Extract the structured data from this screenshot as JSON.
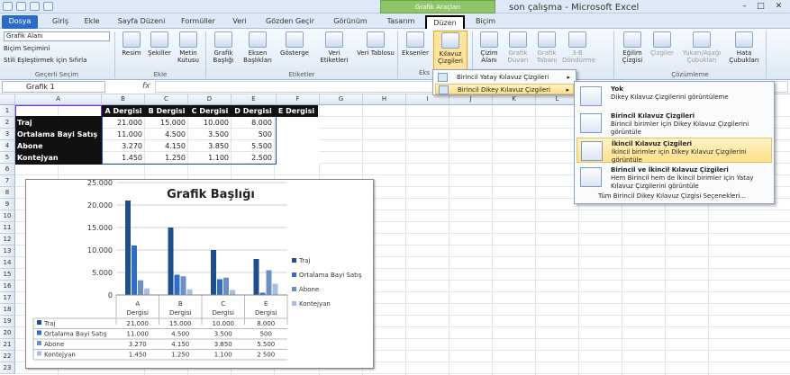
{
  "title": "son çalışma - Microsoft Excel",
  "context_tab": "Grafik Araçları",
  "window_controls": [
    "–",
    "□",
    "✕"
  ],
  "tabs": [
    "Dosya",
    "Giriş",
    "Ekle",
    "Sayfa Düzeni",
    "Formüller",
    "Veri",
    "Gözden Geçir",
    "Görünüm",
    "Tasarım",
    "Düzen",
    "Biçim"
  ],
  "ribbon": {
    "current_selection": "Grafik Alanı",
    "format_selection": "Biçim Seçimini",
    "reset_style": "Stili Eşleştirmek için Sıfırla",
    "group_current": "Geçerli Seçim",
    "group_insert": "Ekle",
    "group_labels": "Etiketler",
    "group_axes": "Eks",
    "group_analysis": "Çözümleme",
    "buttons": [
      "Resim",
      "Şekiller",
      "Metin Kutusu",
      "Grafik Başlığı",
      "Eksen Başlıkları",
      "Gösterge",
      "Veri Etiketleri",
      "Veri Tablosu",
      "Eksenler",
      "Kılavuz Çizgileri",
      "Çizim Alanı",
      "Grafik Duvarı",
      "Grafik Tabanı",
      "3-B Döndürme",
      "Eğilim Çizgisi",
      "Çizgiler",
      "Yukarı/Aşağı Çubukları",
      "Hata Çubukları"
    ]
  },
  "namebox": "Grafik 1",
  "fx": "fx",
  "columns": [
    "A",
    "B",
    "C",
    "D",
    "E",
    "F",
    "G",
    "H",
    "I",
    "J",
    "K",
    "L",
    "M",
    "N"
  ],
  "rows": [
    "1",
    "2",
    "3",
    "4",
    "5",
    "6",
    "7",
    "8",
    "9",
    "10",
    "11",
    "12",
    "13",
    "14",
    "15",
    "16",
    "17",
    "18",
    "19",
    "20",
    "21",
    "22",
    "23"
  ],
  "table": {
    "headers": [
      "A Dergisi",
      "B Dergisi",
      "C Dergisi",
      "D Dergisi",
      "E Dergisi"
    ],
    "rows": [
      {
        "label": "Traj",
        "values": [
          "21.000",
          "15.000",
          "10.000",
          "8.000"
        ]
      },
      {
        "label": "Ortalama Bayi Satış",
        "values": [
          "11.000",
          "4.500",
          "3.500",
          "500"
        ]
      },
      {
        "label": "Abone",
        "values": [
          "3.270",
          "4.150",
          "3.850",
          "5.500"
        ]
      },
      {
        "label": "Kontejyan",
        "values": [
          "1.450",
          "1.250",
          "1.100",
          "2.500"
        ]
      }
    ]
  },
  "menu": {
    "items": [
      "Birincil Yatay Kılavuz Çizgileri",
      "Birincil Dikey Kılavuz Çizgileri"
    ],
    "arrow": "▸",
    "sub": [
      {
        "title": "Yok",
        "desc": "Dikey Kılavuz Çizgilerini görüntüleme"
      },
      {
        "title": "Birincil Kılavuz Çizgileri",
        "desc": "Birincil birimler için Dikey Kılavuz Çizgilerini görüntüle"
      },
      {
        "title": "İkincil Kılavuz Çizgileri",
        "desc": "İkincil birimler için Dikey Kılavuz Çizgilerini görüntüle"
      },
      {
        "title": "Birincil ve İkincil Kılavuz Çizgileri",
        "desc": "Hem Birincil hem de İkincil birimler için Yatay Kılavuz Çizgilerini görüntüle"
      }
    ],
    "more": "Tüm Birincil Dikey Kılavuz Çizgisi Seçenekleri..."
  },
  "colors": {
    "series": [
      "#1f4e8c",
      "#2e6fc4",
      "#6c8fc7",
      "#a9bde0"
    ]
  },
  "chart_data": {
    "type": "bar",
    "title": "Grafik Başlığı",
    "categories": [
      "A Dergisi",
      "B Dergisi",
      "C Dergisi",
      "E Dergisi"
    ],
    "cat_lines": [
      [
        "A",
        "Dergisi"
      ],
      [
        "B",
        "Dergisi"
      ],
      [
        "C",
        "Dergisi"
      ],
      [
        "E",
        "Dergisi"
      ]
    ],
    "ylim": [
      0,
      25000
    ],
    "yticks": [
      "0",
      "5.000",
      "10.000",
      "15.000",
      "20.000",
      "25.000"
    ],
    "grid": true,
    "legend": "right",
    "series": [
      {
        "name": "Traj",
        "values": [
          21000,
          15000,
          10000,
          8000
        ],
        "labels": [
          "21.000",
          "15.000",
          "10.000",
          "8.000"
        ]
      },
      {
        "name": "Ortalama Bayi Satış",
        "values": [
          11000,
          4500,
          3500,
          500
        ],
        "labels": [
          "11.000",
          "4.500",
          "3.500",
          "500"
        ]
      },
      {
        "name": "Abone",
        "values": [
          3270,
          4150,
          3850,
          5500
        ],
        "labels": [
          "3.270",
          "4.150",
          "3.850",
          "5.500"
        ]
      },
      {
        "name": "Kontejyan",
        "values": [
          1450,
          1250,
          1100,
          2500
        ],
        "labels": [
          "1.450",
          "1.250",
          "1.100",
          "2 500"
        ]
      }
    ]
  }
}
